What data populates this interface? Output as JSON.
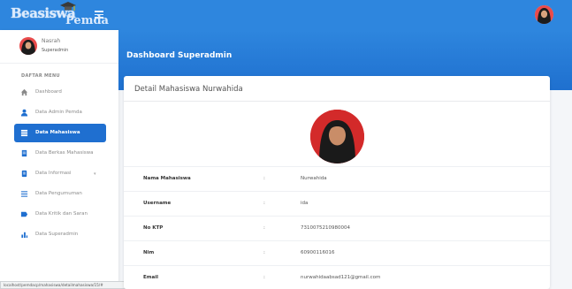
{
  "navbar": {
    "brand_part1": "Beasiswa",
    "brand_part2": "Pemda",
    "accent": "#2e86de"
  },
  "sidebar": {
    "user": {
      "name": "Nasrah",
      "role": "Superadmin"
    },
    "menu_header": "DAFTAR MENU",
    "items": [
      {
        "label": "Dashboard",
        "icon": "dashboard-icon"
      },
      {
        "label": "Data Admin Pemda",
        "icon": "user-icon"
      },
      {
        "label": "Data Mahasiswa",
        "icon": "students-icon",
        "active": true
      },
      {
        "label": "Data Berkas Mahasiswa",
        "icon": "file-icon"
      },
      {
        "label": "Data Informasi",
        "icon": "info-icon",
        "has_caret": true
      },
      {
        "label": "Data Pengumuman",
        "icon": "list-icon"
      },
      {
        "label": "Data Kritik dan Saran",
        "icon": "feedback-icon"
      },
      {
        "label": "Data Superadmin",
        "icon": "superadmin-icon"
      }
    ],
    "active_color": "#1f6fd0"
  },
  "status_bar": {
    "url": "localhost/pemdacp/mahasiswa/detailmahasiswa/15/#"
  },
  "content": {
    "page_title": "Dashboard Superadmin",
    "card_title": "Detail Mahasiswa Nurwahida",
    "separator": ":",
    "fields": [
      {
        "label": "Nama Mahasiswa",
        "value": "Nurwahida"
      },
      {
        "label": "Username",
        "value": "ida"
      },
      {
        "label": "No KTP",
        "value": "7310075210980004"
      },
      {
        "label": "Nim",
        "value": "60900116016"
      },
      {
        "label": "Email",
        "value": "nurwahidaabsad121@gmail.com"
      }
    ],
    "photo_bg": "#d32a2a"
  }
}
